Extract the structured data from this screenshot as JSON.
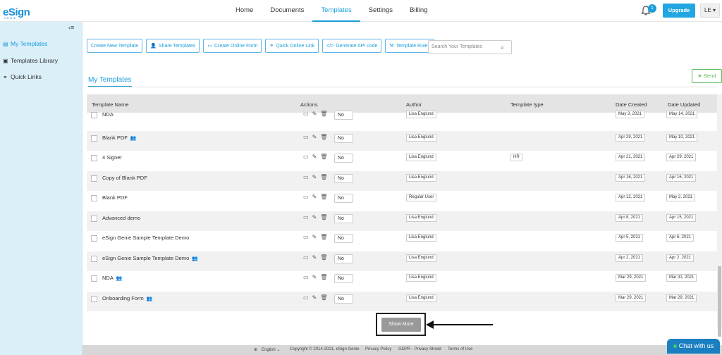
{
  "header": {
    "logo": "eSign",
    "logo_sub": "GENIE",
    "nav": [
      "Home",
      "Documents",
      "Templates",
      "Settings",
      "Billing"
    ],
    "active_nav": "Templates",
    "notification_count": "1",
    "upgrade_label": "Upgrade",
    "user_label": "LE ▾"
  },
  "sidebar": {
    "collapse_icon": "‹≡",
    "items": [
      {
        "label": "My Templates",
        "icon": "template-icon"
      },
      {
        "label": "Templates Library",
        "icon": "library-icon"
      },
      {
        "label": "Quick Links",
        "icon": "link-icon"
      }
    ]
  },
  "toolbar": {
    "buttons": [
      {
        "label": "Create New Template"
      },
      {
        "label": "Share Templates"
      },
      {
        "label": "Create Online Form"
      },
      {
        "label": "Quick Online Link"
      },
      {
        "label": "Generate API code"
      },
      {
        "label": "Template Rules"
      }
    ],
    "search_placeholder": "Search Your Templates"
  },
  "tab": {
    "label": "My Templates"
  },
  "send_label": "Send",
  "table": {
    "columns": [
      "Template Name",
      "Actions",
      "Author",
      "Template type",
      "Date Created",
      "Date Updated"
    ],
    "rows": [
      {
        "name": "NDA",
        "shared": false,
        "select": "No",
        "author": "Lisa Englund",
        "type": "",
        "created": "May 3, 2021",
        "updated": "May 14, 2021"
      },
      {
        "name": "Blank PDF",
        "shared": true,
        "select": "No",
        "author": "Lisa Englund",
        "type": "",
        "created": "Apr 29, 2021",
        "updated": "May 10, 2021"
      },
      {
        "name": "4 Signer",
        "shared": false,
        "select": "No",
        "author": "Lisa Englund",
        "type": "HR",
        "created": "Apr 21, 2021",
        "updated": "Apr 29, 2021"
      },
      {
        "name": "Copy of Blank PDF",
        "shared": false,
        "select": "No",
        "author": "Lisa Englund",
        "type": "",
        "created": "Apr 16, 2021",
        "updated": "Apr 16, 2021"
      },
      {
        "name": "Blank PDF",
        "shared": false,
        "select": "No",
        "author": "Regular User",
        "type": "",
        "created": "Apr 12, 2021",
        "updated": "May 2, 2021"
      },
      {
        "name": "Advanced demo",
        "shared": false,
        "select": "No",
        "author": "Lisa Englund",
        "type": "",
        "created": "Apr 8, 2021",
        "updated": "Apr 15, 2021"
      },
      {
        "name": "eSign Genie Sample Template Demo",
        "shared": false,
        "select": "No",
        "author": "Lisa Englund",
        "type": "",
        "created": "Apr 5, 2021",
        "updated": "Apr 6, 2021"
      },
      {
        "name": "eSign Genie Sample Template Demo",
        "shared": true,
        "select": "No",
        "author": "Lisa Englund",
        "type": "",
        "created": "Apr 2, 2021",
        "updated": "Apr 2, 2021"
      },
      {
        "name": "NDA",
        "shared": true,
        "select": "No",
        "author": "Lisa Englund",
        "type": "",
        "created": "Mar 29, 2021",
        "updated": "Mar 31, 2021"
      },
      {
        "name": "Onboarding Form",
        "shared": true,
        "select": "No",
        "author": "Lisa Englund",
        "type": "",
        "created": "Mar 29, 2021",
        "updated": "Mar 29, 2021"
      }
    ]
  },
  "show_more_label": "Show More",
  "footer": {
    "language": "English",
    "copyright": "Copyright © 2014-2021, eSign Genie",
    "links": [
      "Privacy Policy",
      "GDPR - Privacy Shield",
      "Terms of Use"
    ]
  },
  "chat_label": "Chat with us"
}
